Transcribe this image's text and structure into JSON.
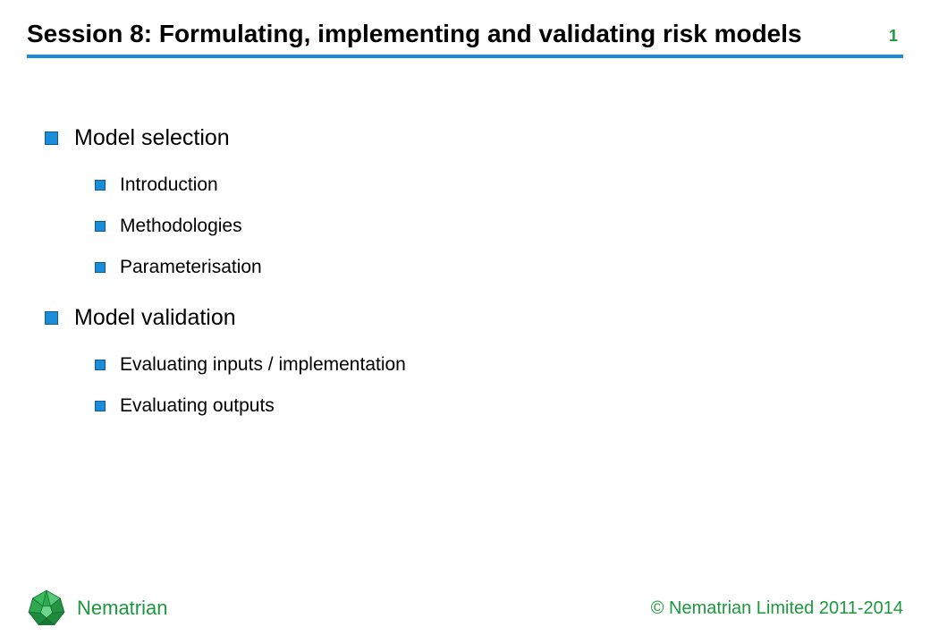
{
  "title": "Session 8: Formulating, implementing and validating risk models",
  "page_number": "1",
  "content": {
    "sections": [
      {
        "label": "Model selection",
        "items": [
          "Introduction",
          "Methodologies",
          "Parameterisation"
        ]
      },
      {
        "label": "Model validation",
        "items": [
          "Evaluating inputs / implementation",
          "Evaluating outputs"
        ]
      }
    ]
  },
  "footer": {
    "brand": "Nematrian",
    "copyright": "© Nematrian Limited 2011-2014"
  }
}
